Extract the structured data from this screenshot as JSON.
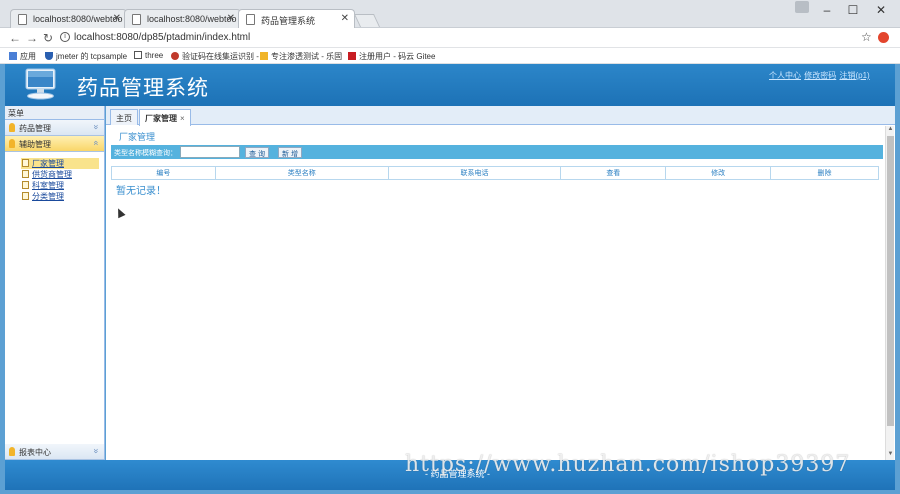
{
  "browser": {
    "tabs": [
      {
        "title": "localhost:8080/webtoo"
      },
      {
        "title": "localhost:8080/webtoo"
      },
      {
        "title": "药品管理系统"
      }
    ],
    "url": "localhost:8080/dp85/ptadmin/index.html",
    "win_min": "–",
    "win_max": "☐",
    "win_close": "✕",
    "bookmarks": [
      {
        "label": "应用",
        "icon": "apps-grid-icon",
        "color": "#4a7fd6"
      },
      {
        "label": "jmeter 的 tcpsample",
        "icon": "shield-icon",
        "color": "#2a5fb0"
      },
      {
        "label": "three",
        "icon": "page-icon",
        "color": "#555555"
      },
      {
        "label": "验证码在线集运识别 -",
        "icon": "bug-icon",
        "color": "#c0392b"
      },
      {
        "label": "专注渗透测试 - 乐固",
        "icon": "star-logo-icon",
        "color": "#f0b429"
      },
      {
        "label": "注册用户 - 码云 Gitee",
        "icon": "gitee-icon",
        "color": "#c71d23"
      }
    ]
  },
  "app": {
    "title": "药品管理系统",
    "header_links": [
      "个人中心",
      "修改密码",
      "注销(p1)"
    ],
    "sidebar_title": "菜单",
    "menu": [
      {
        "label": "药品管理",
        "chevron": "»"
      },
      {
        "label": "辅助管理",
        "chevron": "«"
      }
    ],
    "sub_items": [
      "厂家管理",
      "供货商管理",
      "科室管理",
      "分类管理"
    ],
    "report": {
      "label": "报表中心",
      "chevron": "»"
    },
    "tabs": [
      {
        "label": "主页"
      },
      {
        "label": "厂家管理",
        "close": "×"
      }
    ],
    "page_heading": "厂家管理",
    "search": {
      "label": "类型名称模糊查询：",
      "value": "",
      "search_button": "查 询",
      "add_button": "新 增"
    },
    "grid_columns": [
      "编号",
      "类型名称",
      "联系电话",
      "查看",
      "修改",
      "删除"
    ],
    "empty_message": "暂无记录！",
    "footer_text": "- 药品管理系统 -",
    "watermark": "https://www.huzhan.com/ishop39397"
  }
}
